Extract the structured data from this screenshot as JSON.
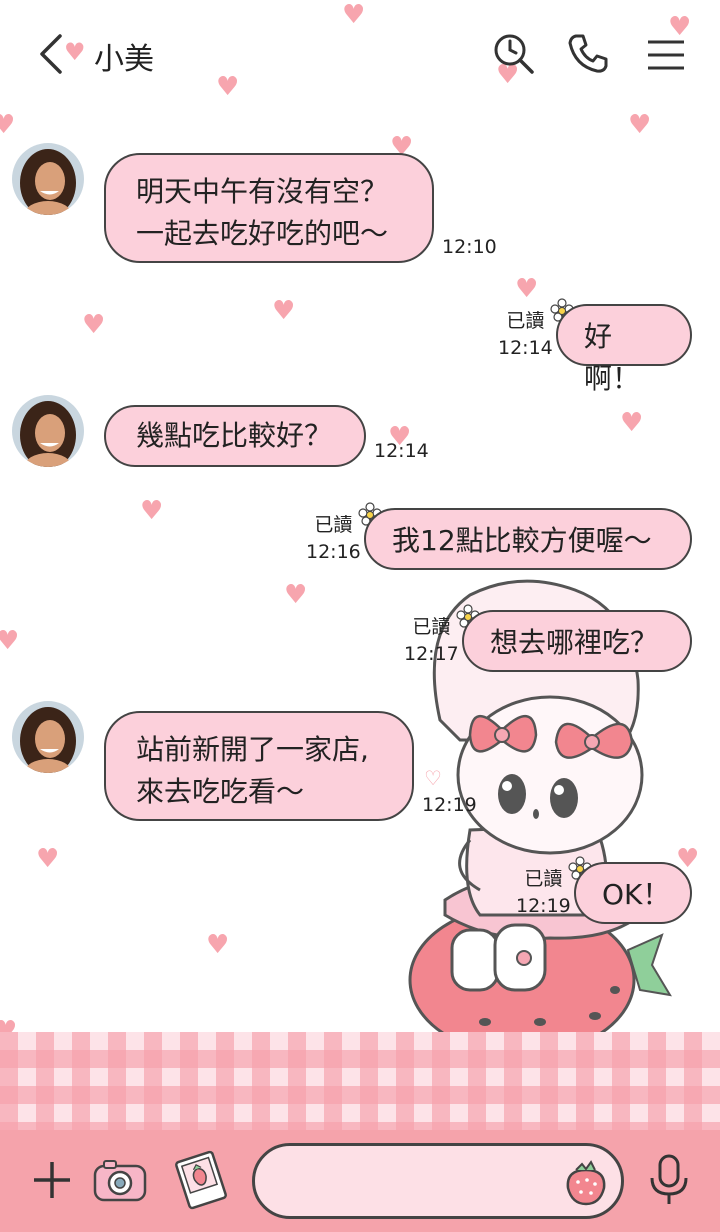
{
  "header": {
    "title": "小美"
  },
  "chat": {
    "messages": [
      {
        "side": "left",
        "lines": [
          "明天中午有沒有空？",
          "一起去吃好吃的吧～"
        ],
        "time": "12:10"
      },
      {
        "side": "right",
        "text": "好啊！",
        "read": "已讀",
        "time": "12:14"
      },
      {
        "side": "left",
        "lines": [
          "幾點吃比較好？"
        ],
        "time": "12:14"
      },
      {
        "side": "right",
        "text": "我12點比較方便喔～",
        "read": "已讀",
        "time": "12:16"
      },
      {
        "side": "right",
        "text": "想去哪裡吃？",
        "read": "已讀",
        "time": "12:17"
      },
      {
        "side": "left",
        "lines": [
          "站前新開了一家店,",
          "來去吃吃看～"
        ],
        "time": "12:19"
      },
      {
        "side": "right",
        "text": "OK！",
        "read": "已讀",
        "time": "12:19"
      }
    ]
  },
  "colors": {
    "bubble": "#fcd0db",
    "heart": "#f7a5ae",
    "bar": "#f5a3ab"
  },
  "icons": [
    "back-arrow-icon",
    "search-history-icon",
    "phone-icon",
    "menu-icon",
    "plus-icon",
    "camera-icon",
    "photo-icon",
    "sticker-strawberry-icon",
    "microphone-icon"
  ]
}
